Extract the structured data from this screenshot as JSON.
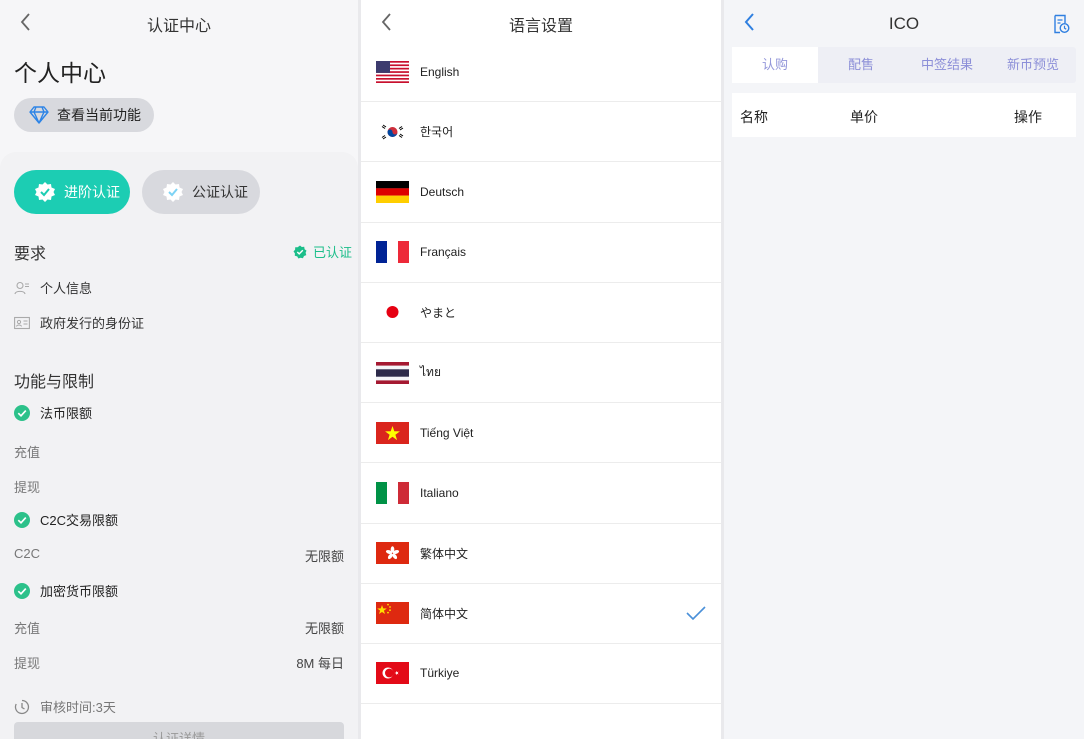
{
  "auth": {
    "title": "认证中心",
    "heading": "个人中心",
    "feature_button": "查看当前功能",
    "tabs": [
      "进阶认证",
      "公证认证"
    ],
    "requirements_title": "要求",
    "verified_label": "已认证",
    "requirements": [
      "个人信息",
      "政府发行的身份证"
    ],
    "limits_title": "功能与限制",
    "fiat_limit": "法币限额",
    "fiat_rows": [
      {
        "label": "充值",
        "value": ""
      },
      {
        "label": "提现",
        "value": ""
      }
    ],
    "c2c_limit": "C2C交易限额",
    "c2c_rows": [
      {
        "label": "C2C",
        "value": "无限额"
      }
    ],
    "crypto_limit": "加密货币限额",
    "crypto_rows": [
      {
        "label": "充值",
        "value": "无限额"
      },
      {
        "label": "提现",
        "value": "8M 每日"
      }
    ],
    "review_time": "审核时间:3天",
    "detail_button": "认证详情",
    "accent_color": "#1ccdb3",
    "verified_color": "#1cbe8a"
  },
  "language": {
    "title": "语言设置",
    "items": [
      {
        "label": "English",
        "flag": "us-flag-icon"
      },
      {
        "label": "한국어",
        "flag": "kr-flag-icon"
      },
      {
        "label": "Deutsch",
        "flag": "de-flag-icon"
      },
      {
        "label": "Français",
        "flag": "fr-flag-icon"
      },
      {
        "label": "やまと",
        "flag": "jp-flag-icon"
      },
      {
        "label": "ไทย",
        "flag": "th-flag-icon"
      },
      {
        "label": "Tiếng Việt",
        "flag": "vn-flag-icon"
      },
      {
        "label": "Italiano",
        "flag": "it-flag-icon"
      },
      {
        "label": "繁体中文",
        "flag": "hk-flag-icon"
      },
      {
        "label": "简体中文",
        "flag": "cn-flag-icon",
        "selected": true
      },
      {
        "label": "Türkiye",
        "flag": "tr-flag-icon"
      }
    ]
  },
  "ico": {
    "title": "ICO",
    "tabs": [
      "认购",
      "配售",
      "中签结果",
      "新币预览"
    ],
    "active_tab": 0,
    "columns": [
      "名称",
      "单价",
      "操作"
    ],
    "accent_color": "#2f7fe0"
  }
}
